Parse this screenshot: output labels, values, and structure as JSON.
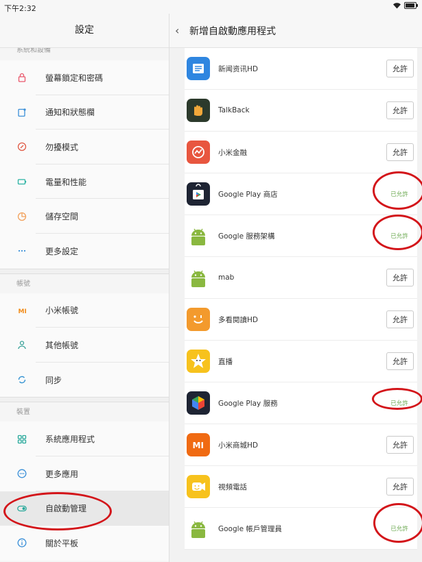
{
  "status": {
    "time": "下午2:32"
  },
  "left": {
    "title": "設定",
    "cut_label": "系統和設備",
    "group1": [
      {
        "label": "螢幕鎖定和密碼",
        "icon": "lock-icon",
        "color": "#e9566a"
      },
      {
        "label": "通知和狀態欄",
        "icon": "notification-icon",
        "color": "#3a8fd8"
      },
      {
        "label": "勿擾模式",
        "icon": "do-not-disturb-icon",
        "color": "#e05a45"
      },
      {
        "label": "電量和性能",
        "icon": "battery-icon",
        "color": "#28b2a2"
      },
      {
        "label": "儲存空間",
        "icon": "storage-icon",
        "color": "#f2a15c"
      },
      {
        "label": "更多設定",
        "icon": "more-icon",
        "color": "#3a8fd8"
      }
    ],
    "section_account": "帳號",
    "group2": [
      {
        "label": "小米帳號",
        "icon": "mi-account-icon",
        "color": "#f28c1a"
      },
      {
        "label": "其他帳號",
        "icon": "user-icon",
        "color": "#3ba39a"
      },
      {
        "label": "同步",
        "icon": "sync-icon",
        "color": "#2e8fd1"
      }
    ],
    "section_device": "裝置",
    "group3": [
      {
        "label": "系統應用程式",
        "icon": "apps-icon",
        "color": "#27a89a"
      },
      {
        "label": "更多應用",
        "icon": "more-apps-icon",
        "color": "#3a8fd8"
      },
      {
        "label": "自啟動管理",
        "icon": "toggle-icon",
        "color": "#27a89a"
      },
      {
        "label": "關於平板",
        "icon": "info-icon",
        "color": "#3a8fd8"
      }
    ]
  },
  "right": {
    "title": "新增自啟動應用程式",
    "allow_label": "允許",
    "allowed_label": "已允許",
    "apps": [
      {
        "name": "新闻资讯HD",
        "state": "allow",
        "icon": "news-icon",
        "bg": "#2f86e0"
      },
      {
        "name": "TalkBack",
        "state": "allow",
        "icon": "talkback-icon",
        "bg": "#2c3a2c"
      },
      {
        "name": "小米金融",
        "state": "allow",
        "icon": "finance-icon",
        "bg": "#e8563f"
      },
      {
        "name": "Google Play 商店",
        "state": "allowed",
        "icon": "play-store-icon",
        "bg": "#1e2433"
      },
      {
        "name": "Google 服務架構",
        "state": "allowed",
        "icon": "android-icon",
        "bg": "#ffffff"
      },
      {
        "name": "mab",
        "state": "allow",
        "icon": "android-icon",
        "bg": "#ffffff"
      },
      {
        "name": "多看閱讀HD",
        "state": "allow",
        "icon": "reader-icon",
        "bg": "#f39a2d"
      },
      {
        "name": "直播",
        "state": "allow",
        "icon": "live-icon",
        "bg": "#f7c21d"
      },
      {
        "name": "Google Play 服務",
        "state": "allowed",
        "icon": "play-services-icon",
        "bg": "#1e2433"
      },
      {
        "name": "小米商城HD",
        "state": "allow",
        "icon": "mi-store-icon",
        "bg": "#f06a12"
      },
      {
        "name": "視頻電話",
        "state": "allow",
        "icon": "video-call-icon",
        "bg": "#f7c21d"
      },
      {
        "name": "Google 帳戶管理員",
        "state": "allowed",
        "icon": "android-icon",
        "bg": "#ffffff"
      }
    ]
  },
  "colors": {
    "annotation": "#d3151a",
    "allowed_text": "#6aa84f",
    "android": "#8ab840"
  }
}
